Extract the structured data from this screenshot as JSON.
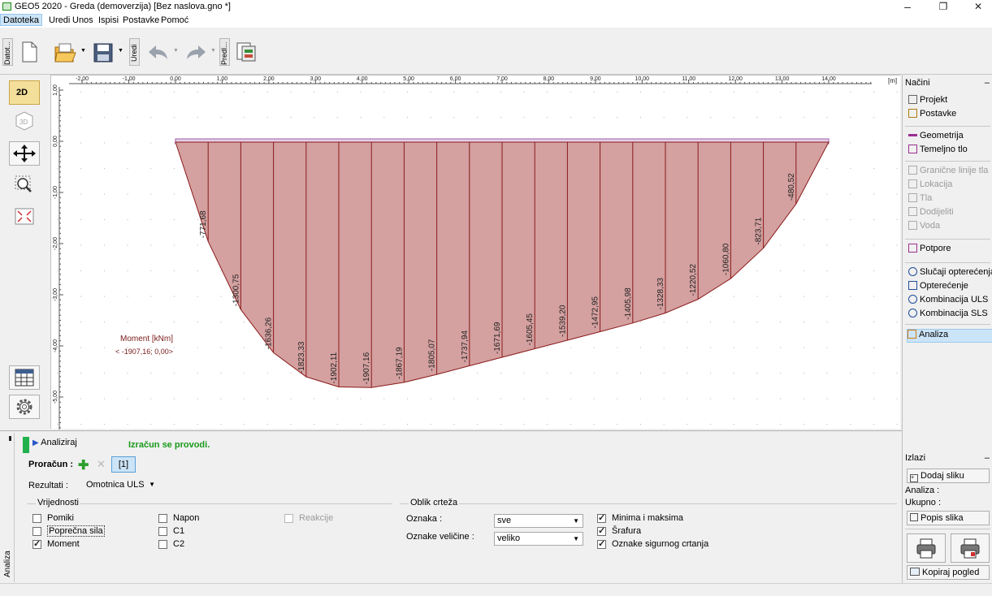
{
  "window": {
    "title": "GEO5 2020 - Greda (demoverzija) [Bez naslova.gno *]",
    "minimize": "–",
    "maximize": "❐",
    "close": "✕"
  },
  "menu": [
    "Datoteka",
    "Uredi",
    "Unos",
    "Ispisi",
    "Postavke",
    "Pomoć"
  ],
  "toolbar": {
    "group_datoteka": "Datot...",
    "group_uredi": "Uredi",
    "group_predlosci": "Predl..."
  },
  "left_tools": {
    "view_2d": "2D",
    "view_3d": "3D"
  },
  "chart_data": {
    "type": "area",
    "x_unit": "[m]",
    "x_ticks": [
      "-2,00",
      "-1,00",
      "0,00",
      "1,00",
      "2,00",
      "3,00",
      "4,00",
      "5,00",
      "6,00",
      "7,00",
      "8,00",
      "9,00",
      "10,00",
      "11,00",
      "12,00",
      "13,00",
      "14,00"
    ],
    "y_ticks": [
      "1,00",
      "0,00",
      "-1,00",
      "-2,00",
      "-3,00",
      "-4,00",
      "-5,00",
      "-6,00"
    ],
    "beam": {
      "x_start": 0,
      "x_end": 14
    },
    "series": [
      {
        "name": "Moment [kNm]",
        "x": [
          0.7,
          1.4,
          2.1,
          2.8,
          3.5,
          4.2,
          4.9,
          5.6,
          6.3,
          7.0,
          7.7,
          8.4,
          9.1,
          9.8,
          10.5,
          11.2,
          11.9,
          12.6,
          13.3
        ],
        "values": [
          -771.68,
          -1300.75,
          -1636.26,
          -1823.33,
          -1902.11,
          -1907.16,
          -1867.19,
          -1805.07,
          -1737.94,
          -1671.69,
          -1605.45,
          -1539.2,
          -1472.95,
          -1405.98,
          -1328.33,
          -1220.52,
          -1060.8,
          -823.71,
          -480.52
        ],
        "labels": [
          "-771,68",
          "-1300,75",
          "-1636,26",
          "-1823,33",
          "-1902,11",
          "-1907,16",
          "-1867,19",
          "-1805,07",
          "-1737,94",
          "-1671,69",
          "-1605,45",
          "-1539,20",
          "-1472,95",
          "-1405,98",
          "-1328,33",
          "-1220,52",
          "-1060,80",
          "-823,71",
          "-480,52"
        ]
      }
    ],
    "extreme_label": "< -1907,16; 0,00>",
    "fill_color": "#d4a0a0",
    "line_color": "#8b1a1a"
  },
  "right_panel": {
    "nacini_title": "Načini",
    "items": [
      {
        "label": "Projekt",
        "icon": "document-icon",
        "state": "normal"
      },
      {
        "label": "Postavke",
        "icon": "gear-icon",
        "state": "normal"
      },
      {
        "label": "Geometrija",
        "icon": "beam-icon",
        "state": "normal"
      },
      {
        "label": "Temeljno tlo",
        "icon": "subsoil-icon",
        "state": "normal"
      },
      {
        "label": "Granične linije tla",
        "icon": "interface-icon",
        "state": "disabled"
      },
      {
        "label": "Lokacija",
        "icon": "location-icon",
        "state": "disabled"
      },
      {
        "label": "Tla",
        "icon": "soil-icon",
        "state": "disabled"
      },
      {
        "label": "Dodijeliti",
        "icon": "assign-icon",
        "state": "disabled"
      },
      {
        "label": "Voda",
        "icon": "water-icon",
        "state": "disabled"
      },
      {
        "label": "Potpore",
        "icon": "supports-icon",
        "state": "normal"
      },
      {
        "label": "Slučaji opterećenja",
        "icon": "load-case-icon",
        "state": "normal"
      },
      {
        "label": "Opterećenje",
        "icon": "load-icon",
        "state": "normal"
      },
      {
        "label": "Kombinacija ULS",
        "icon": "combination-uls-icon",
        "state": "normal"
      },
      {
        "label": "Kombinacija SLS",
        "icon": "combination-sls-icon",
        "state": "normal"
      },
      {
        "label": "Analiza",
        "icon": "analysis-icon",
        "state": "selected"
      }
    ],
    "izlazi_title": "Izlazi",
    "dodaj_sliku": "Dodaj sliku",
    "analiza_label": "Analiza :",
    "ukupno_label": "Ukupno :",
    "popis_slika": "Popis slika",
    "kopiraj_pogled": "Kopiraj pogled"
  },
  "bottom": {
    "side_tab": "Analiza",
    "analyze_button": "Analiziraj",
    "status": "Izračun se provodi.",
    "proracun_label": "Proračun :",
    "proracun_tab": "[1]",
    "rezultati_label": "Rezultati :",
    "rezultati_value": "Omotnica ULS",
    "vrijednosti_title": "Vrijednosti",
    "checkboxes": [
      {
        "label": "Pomiki",
        "checked": false
      },
      {
        "label": "Poprečna sila",
        "checked": false
      },
      {
        "label": "Moment",
        "checked": true
      },
      {
        "label": "Napon",
        "checked": false
      },
      {
        "label": "C1",
        "checked": false
      },
      {
        "label": "C2",
        "checked": false
      },
      {
        "label": "Reakcije",
        "checked": false
      }
    ],
    "oblik_title": "Oblik crteža",
    "oznaka_label": "Oznaka :",
    "oznaka_value": "sve",
    "oznake_velicine_label": "Oznake veličine :",
    "oznake_velicine_value": "veliko",
    "options": [
      {
        "label": "Minima i maksima",
        "checked": true
      },
      {
        "label": "Šrafura",
        "checked": true
      },
      {
        "label": "Oznake sigurnog crtanja",
        "checked": true
      }
    ]
  }
}
